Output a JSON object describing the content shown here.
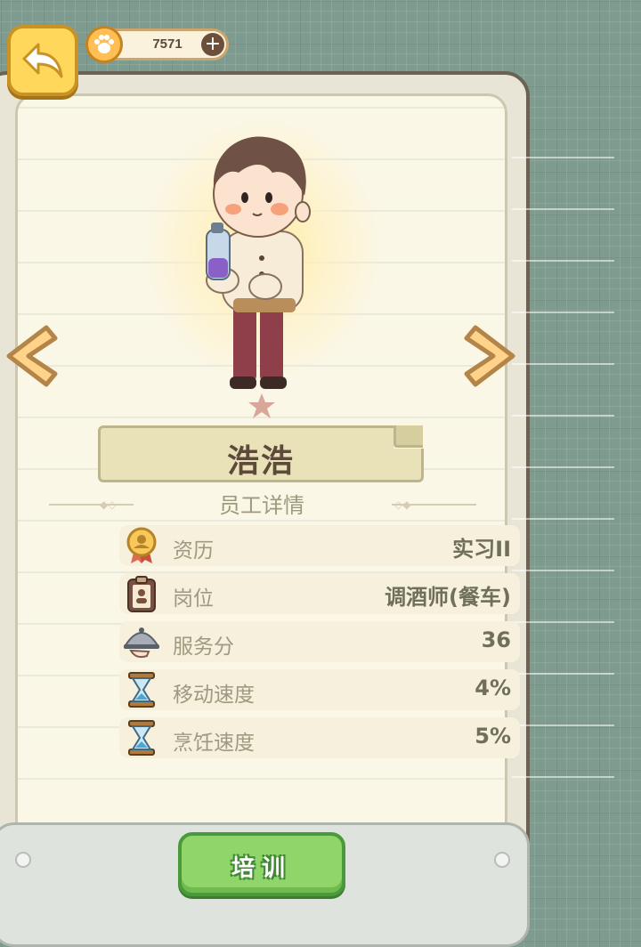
{
  "currency": {
    "amount": "7571",
    "add_label": "+"
  },
  "employee": {
    "name": "浩浩",
    "star_level": 1
  },
  "details": {
    "title": "员工详情",
    "stats": [
      {
        "label": "资历",
        "value": "实习II",
        "icon": "medal-icon"
      },
      {
        "label": "岗位",
        "value": "调酒师(餐车)",
        "icon": "clipboard-icon"
      },
      {
        "label": "服务分",
        "value": "36",
        "icon": "serving-cloche-icon"
      },
      {
        "label": "移动速度",
        "value": "4%",
        "icon": "hourglass-icon"
      },
      {
        "label": "烹饪速度",
        "value": "5%",
        "icon": "hourglass-icon"
      }
    ]
  },
  "actions": {
    "train_label": "培训"
  },
  "colors": {
    "background": "#7d9b8f",
    "card": "#fbf7e6",
    "accent_yellow": "#ffd75a",
    "button_green": "#8fd56a"
  }
}
